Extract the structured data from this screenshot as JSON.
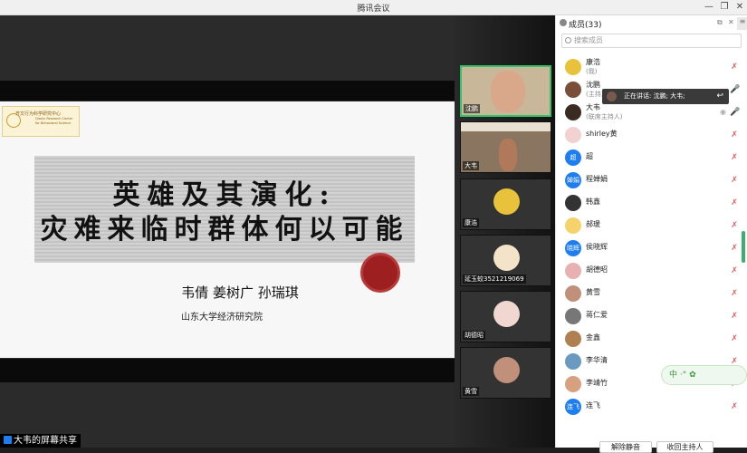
{
  "window": {
    "title": "腾讯会议",
    "min": "—",
    "restore": "❐",
    "close": "✕"
  },
  "slide": {
    "logo_cn": "齐文行为科学研究中心",
    "logo_en": "Qianlu Research Center for Behavioral Science",
    "title_line1": "英雄及其演化:",
    "title_line2": "灾难来临时群体何以可能",
    "authors": "韦倩 姜树广 孙瑞琪",
    "institution": "山东大学经济研究院"
  },
  "share_label": "大韦的屏幕共享",
  "thumbs": [
    {
      "name": "沈鹏"
    },
    {
      "name": "大韦"
    },
    {
      "name": "康浩"
    },
    {
      "name": "延玉蛟3521219069"
    },
    {
      "name": "胡德昭"
    },
    {
      "name": "黄雪"
    }
  ],
  "panel": {
    "title": "成员(33)",
    "search_placeholder": "搜索成员",
    "speaking": "正在讲话: 沈鹏; 大韦;",
    "members": [
      {
        "name": "康浩",
        "role": "(我)",
        "avatar": "#e8c23a",
        "initial": ""
      },
      {
        "name": "沈鹏",
        "role": "(主持人)",
        "avatar": "#7a4f3a",
        "initial": ""
      },
      {
        "name": "大韦",
        "role": "(联席主持人)",
        "avatar": "#3a2a22",
        "initial": ""
      },
      {
        "name": "shirley黄",
        "role": "",
        "avatar": "#f2d1d1",
        "initial": ""
      },
      {
        "name": "超",
        "role": "",
        "avatar": "#1e7ef0",
        "initial": "超"
      },
      {
        "name": "程婵娟",
        "role": "",
        "avatar": "#1e7ef0",
        "initial": "婵娟"
      },
      {
        "name": "韩鑫",
        "role": "",
        "avatar": "#333333",
        "initial": ""
      },
      {
        "name": "郝瑗",
        "role": "",
        "avatar": "#f6d36a",
        "initial": ""
      },
      {
        "name": "侯晓辉",
        "role": "",
        "avatar": "#1e7ef0",
        "initial": "晓辉"
      },
      {
        "name": "胡德昭",
        "role": "",
        "avatar": "#e8b0b0",
        "initial": ""
      },
      {
        "name": "黄雪",
        "role": "",
        "avatar": "#c0907a",
        "initial": ""
      },
      {
        "name": "蒋仁爱",
        "role": "",
        "avatar": "#777777",
        "initial": ""
      },
      {
        "name": "金鑫",
        "role": "",
        "avatar": "#b08050",
        "initial": ""
      },
      {
        "name": "李华清",
        "role": "",
        "avatar": "#6a9ac0",
        "initial": ""
      },
      {
        "name": "李靖竹",
        "role": "",
        "avatar": "#d9a080",
        "initial": ""
      },
      {
        "name": "连飞",
        "role": "",
        "avatar": "#1e7ef0",
        "initial": "连飞"
      }
    ],
    "btn_mute": "解除静音",
    "btn_reclaim": "收回主持人"
  },
  "ime": "中 ·° ✿"
}
